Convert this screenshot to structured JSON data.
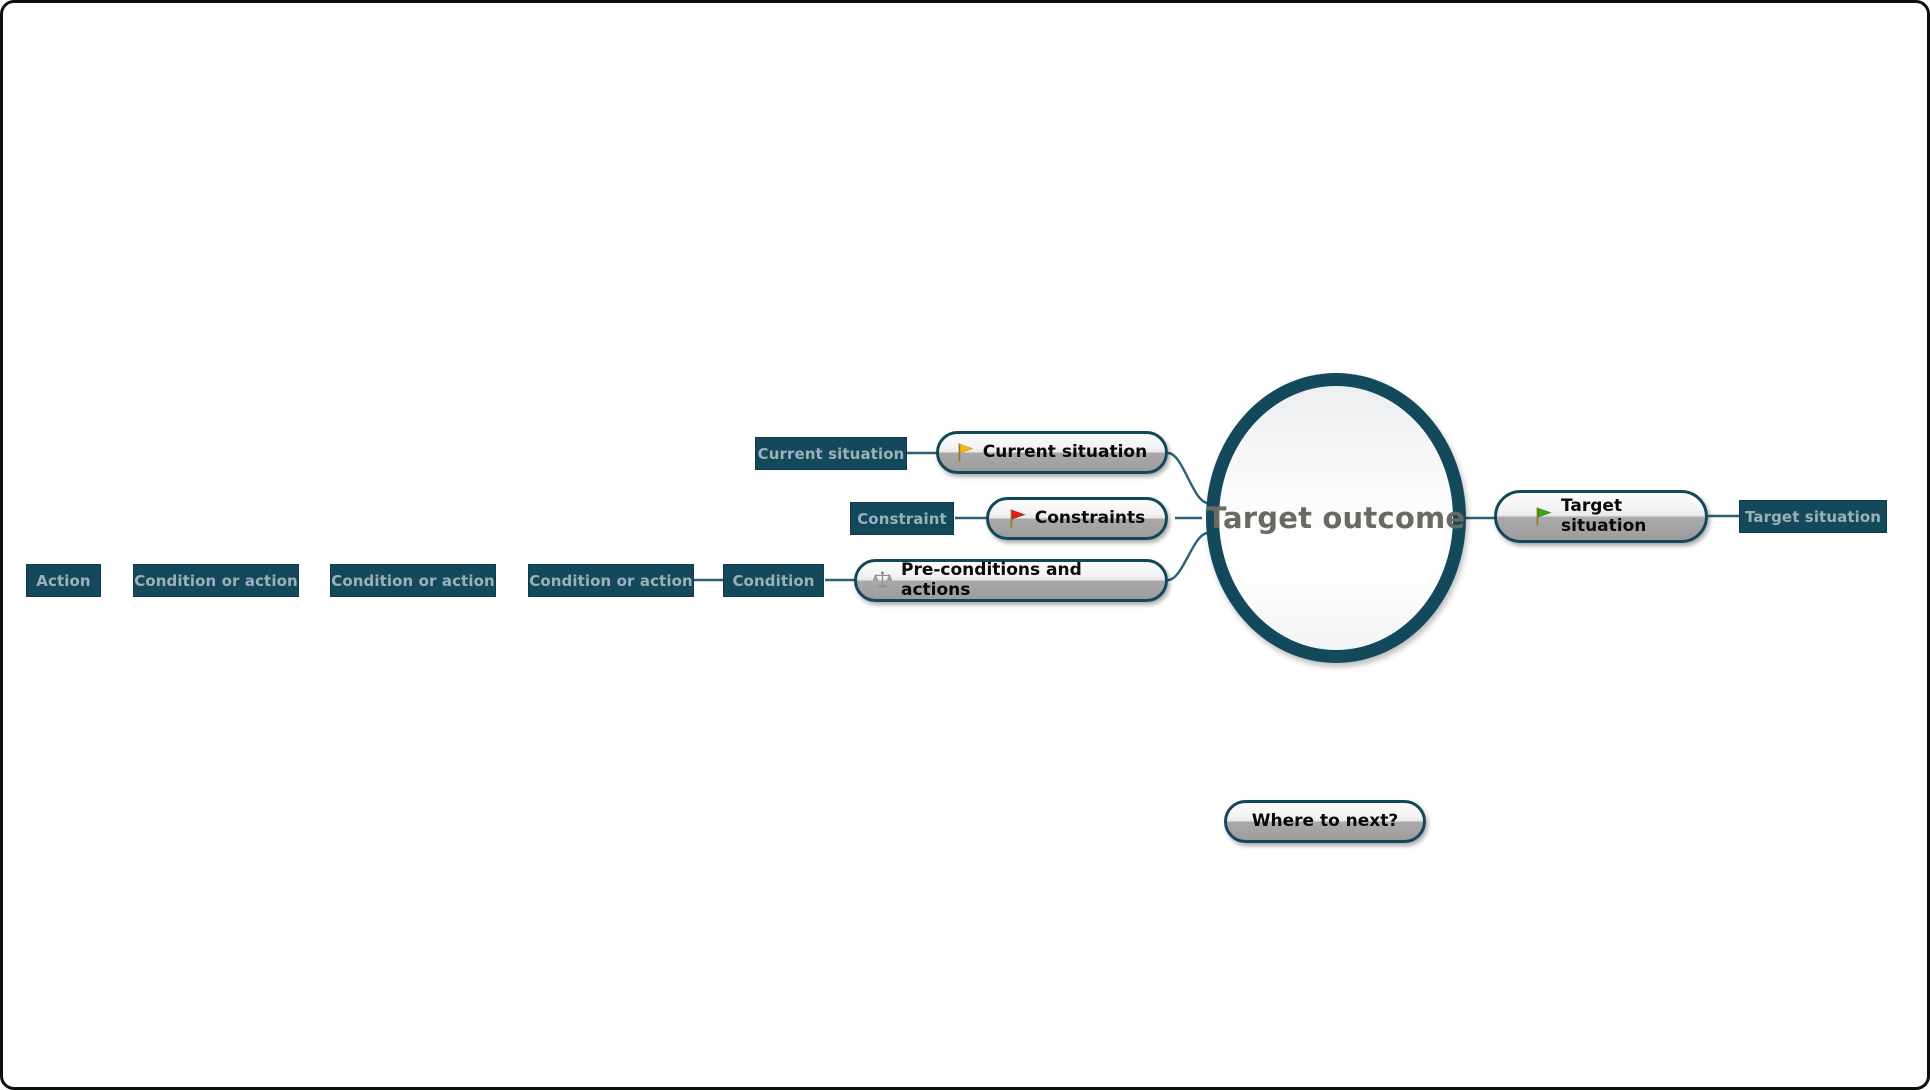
{
  "diagram": {
    "type": "mind-map",
    "title": "Target outcome",
    "background_color": "#ffffff",
    "border_color": "#0b0f0a",
    "accent_color": "#14495c",
    "leaf_text_color": "#9bb0b8",
    "center": {
      "label": "Target outcome",
      "shape": "circle",
      "ring_color": "#14495c",
      "text_color": "#6b6a62"
    },
    "branches": [
      {
        "id": "current-situation",
        "label": "Current situation",
        "icon": "flag-yellow-icon",
        "icon_color": "#f2bd1d",
        "side": "left",
        "children": [
          {
            "id": "current-situation-leaf",
            "label": "Current situation"
          }
        ]
      },
      {
        "id": "constraints",
        "label": "Constraints",
        "icon": "flag-red-icon",
        "icon_color": "#e02020",
        "side": "left",
        "children": [
          {
            "id": "constraint-leaf",
            "label": "Constraint"
          }
        ]
      },
      {
        "id": "pre-conditions-and-actions",
        "label": "Pre-conditions and actions",
        "icon": "scales-icon",
        "icon_color": "#8d9196",
        "side": "left",
        "children": [
          {
            "id": "condition-leaf",
            "label": "Condition"
          },
          {
            "id": "condition-or-action-leaf-3",
            "label": "Condition or action"
          },
          {
            "id": "condition-or-action-leaf-2",
            "label": "Condition or action"
          },
          {
            "id": "condition-or-action-leaf-1",
            "label": "Condition or action"
          },
          {
            "id": "action-leaf",
            "label": "Action"
          }
        ]
      },
      {
        "id": "target-situation",
        "label": "Target situation",
        "label_line_1": "Target",
        "label_line_2": "situation",
        "icon": "flag-green-icon",
        "icon_color": "#3aa81a",
        "side": "right",
        "children": [
          {
            "id": "target-situation-leaf",
            "label": "Target situation"
          }
        ]
      }
    ],
    "floating_nodes": [
      {
        "id": "where-to-next",
        "label": "Where to next?",
        "icon": null
      }
    ]
  }
}
